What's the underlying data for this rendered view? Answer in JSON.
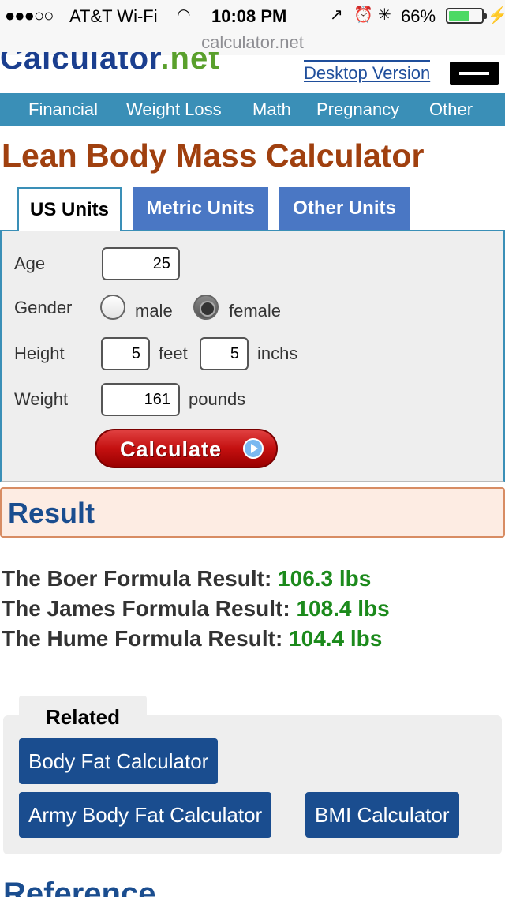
{
  "status_bar": {
    "signal": "●●●○○",
    "carrier": "AT&T Wi-Fi",
    "time": "10:08 PM",
    "battery_pct_text": "66%",
    "battery_level": 0.66
  },
  "url_bar": {
    "domain": "calculator.net"
  },
  "header": {
    "logo_text": "Calculator",
    "logo_suffix": ".net",
    "desktop_link": "Desktop Version"
  },
  "topnav": [
    "Financial",
    "Weight Loss",
    "Math",
    "Pregnancy",
    "Other"
  ],
  "page_title": "Lean Body Mass Calculator",
  "tabs": [
    "US Units",
    "Metric Units",
    "Other Units"
  ],
  "form": {
    "age_label": "Age",
    "age_value": "25",
    "gender_label": "Gender",
    "gender_options": [
      "male",
      "female"
    ],
    "gender_selected": "female",
    "height_label": "Height",
    "height_feet": "5",
    "height_feet_unit": "feet",
    "height_inches": "5",
    "height_inches_unit": "inchs",
    "weight_label": "Weight",
    "weight_value": "161",
    "weight_unit": "pounds",
    "calculate_label": "Calculate"
  },
  "result": {
    "title": "Result",
    "lines": [
      {
        "label": "The Boer Formula Result:",
        "value": "106.3 lbs"
      },
      {
        "label": "The James Formula Result:",
        "value": "108.4 lbs"
      },
      {
        "label": "The Hume Formula Result:",
        "value": "104.4 lbs"
      }
    ]
  },
  "related": {
    "title": "Related",
    "links": [
      "Body Fat Calculator",
      "Army Body Fat Calculator",
      "BMI Calculator"
    ]
  },
  "reference_heading": "Reference",
  "colors": {
    "nav_bg": "#3a8fb7",
    "title_color": "#a0400f",
    "tab_inactive": "#4a77c4",
    "result_value": "#1c8a1c",
    "button_blue": "#1a4d8f"
  }
}
